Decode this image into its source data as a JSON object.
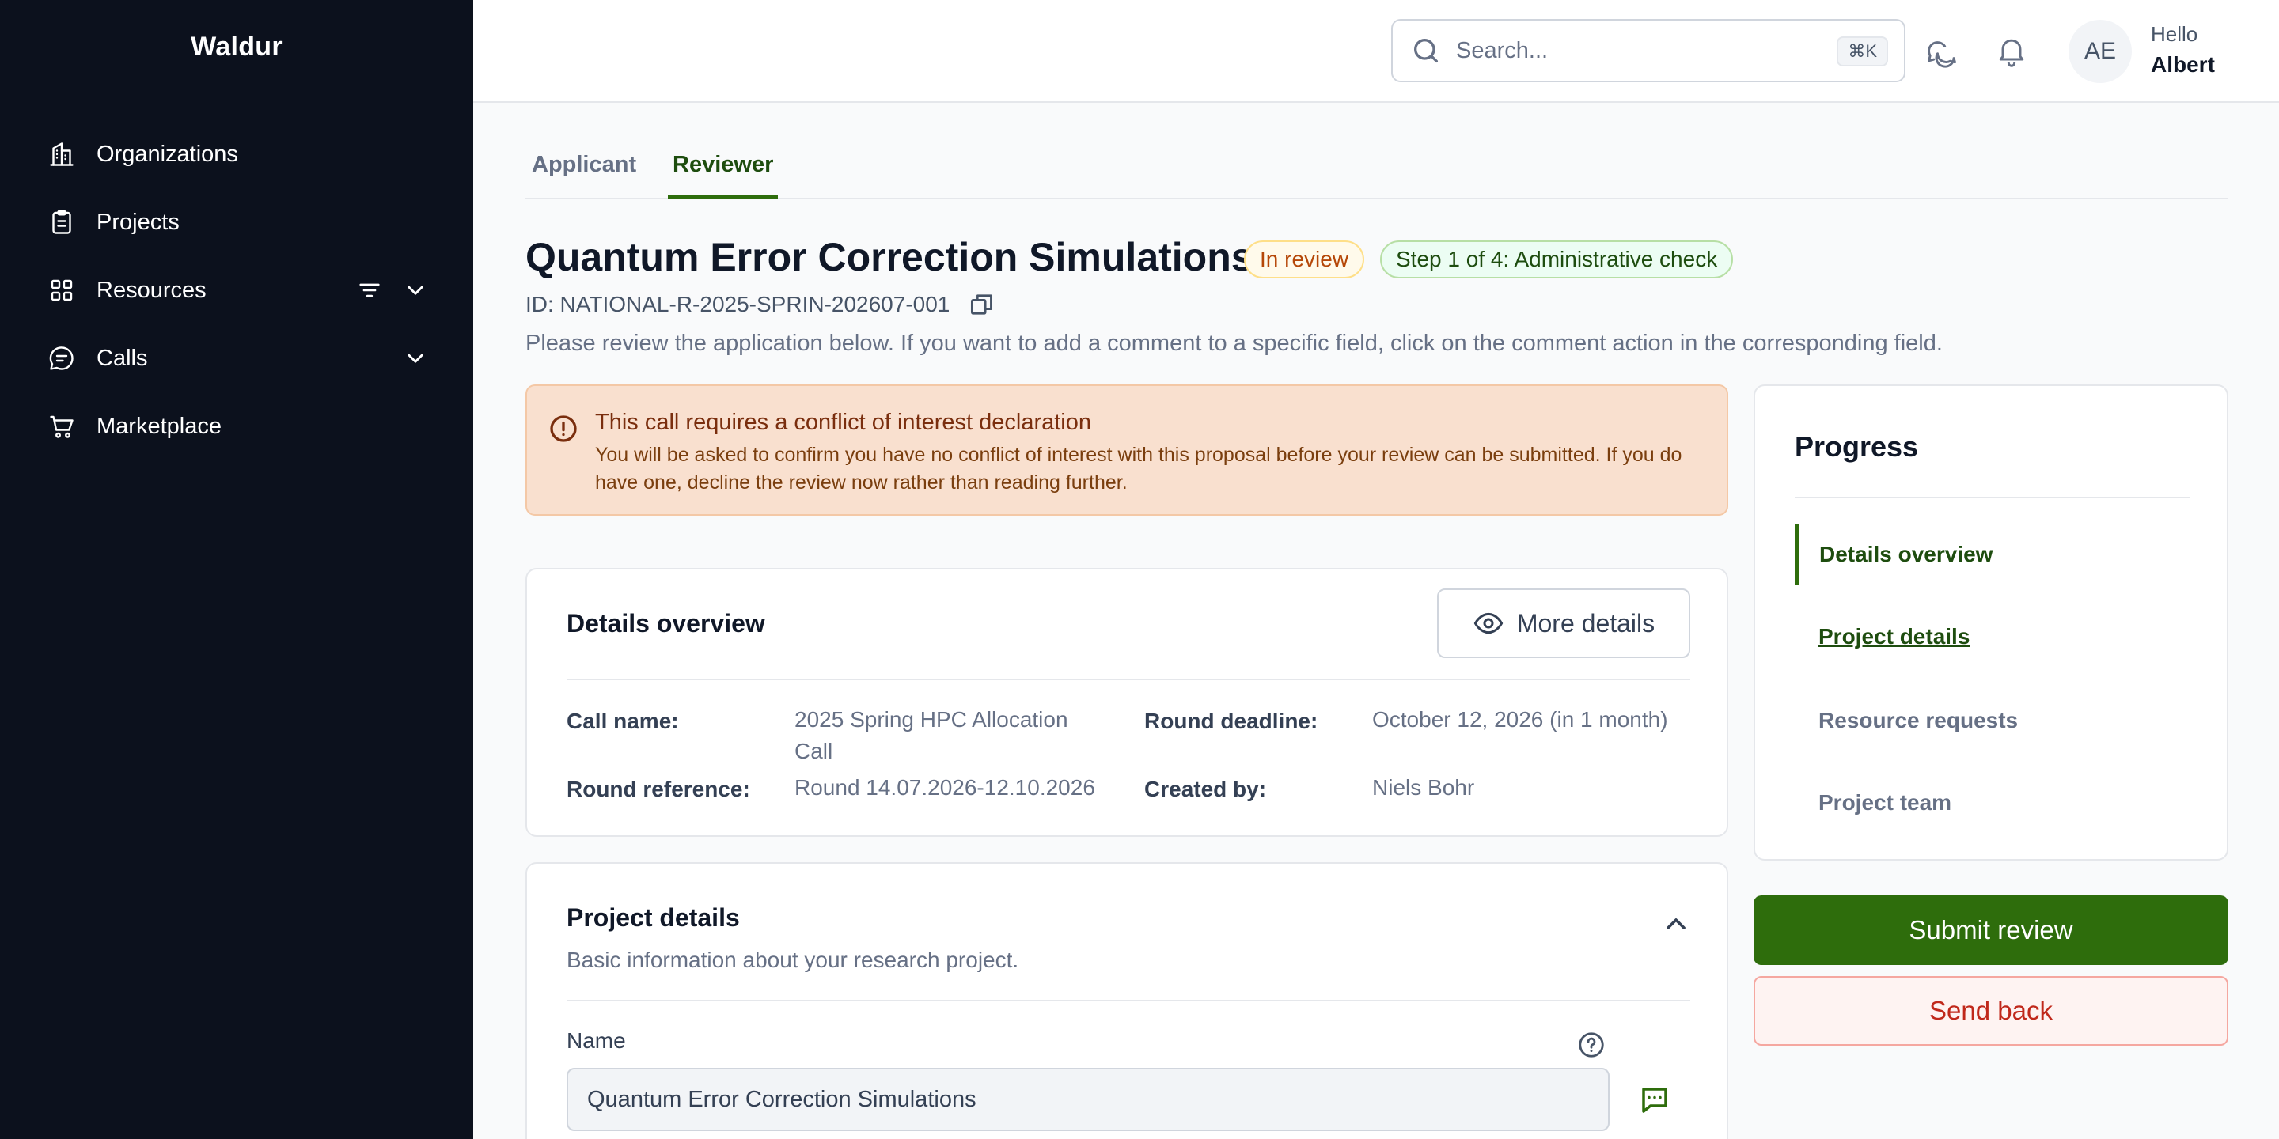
{
  "sidebar": {
    "brand": "Waldur",
    "items": [
      {
        "label": "Organizations",
        "icon": "building-icon"
      },
      {
        "label": "Projects",
        "icon": "clipboard-icon"
      },
      {
        "label": "Resources",
        "icon": "grid-icon"
      },
      {
        "label": "Calls",
        "icon": "chat-bubble-icon"
      },
      {
        "label": "Marketplace",
        "icon": "cart-icon"
      }
    ]
  },
  "header": {
    "search_placeholder": "Search...",
    "search_shortcut": "⌘K",
    "avatar_initials": "AE",
    "greeting": "Hello",
    "user_name": "Albert"
  },
  "tabs": [
    {
      "label": "Applicant",
      "active": false
    },
    {
      "label": "Reviewer",
      "active": true
    }
  ],
  "page": {
    "title": "Quantum Error Correction Simulations",
    "status_badge": "In review",
    "step_badge": "Step 1 of 4: Administrative check",
    "id_text": "ID: NATIONAL-R-2025-SPRIN-202607-001",
    "intro": "Please review the application below. If you want to add a comment to a specific field, click on the comment action in the corresponding field."
  },
  "alert": {
    "title": "This call requires a conflict of interest declaration",
    "body": "You will be asked to confirm you have no conflict of interest with this proposal before your review can be submitted. If you do have one, decline the review now rather than reading further."
  },
  "details": {
    "title": "Details overview",
    "more_button": "More details",
    "fields": {
      "call_name_label": "Call name:",
      "call_name_value": "2025 Spring HPC Allocation Call",
      "round_deadline_label": "Round deadline:",
      "round_deadline_value": "October 12, 2026 (in 1 month)",
      "round_reference_label": "Round reference:",
      "round_reference_value": "Round 14.07.2026-12.10.2026",
      "created_by_label": "Created by:",
      "created_by_value": "Niels Bohr"
    }
  },
  "project_details": {
    "title": "Project details",
    "subtitle": "Basic information about your research project.",
    "name_label": "Name",
    "name_value": "Quantum Error Correction Simulations"
  },
  "progress": {
    "title": "Progress",
    "steps": [
      {
        "label": "Details overview",
        "state": "active"
      },
      {
        "label": "Project details",
        "state": "link"
      },
      {
        "label": "Resource requests",
        "state": "default"
      },
      {
        "label": "Project team",
        "state": "default"
      }
    ]
  },
  "actions": {
    "submit": "Submit review",
    "send_back": "Send back"
  },
  "colors": {
    "sidebar_bg": "#0c111d",
    "accent_green": "#2e6d0c",
    "alert_bg": "#f9e0cf",
    "danger": "#c0281b"
  }
}
